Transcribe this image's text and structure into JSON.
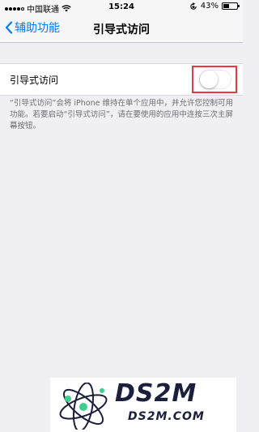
{
  "status_bar": {
    "carrier": "中国联通",
    "time": "15:24",
    "battery_percent": "43%",
    "battery_level": 0.43
  },
  "nav": {
    "back_label": "辅助功能",
    "title": "引导式访问"
  },
  "setting": {
    "label": "引导式访问",
    "toggle_on": false
  },
  "footnote": "“引导式访问”会将 iPhone 维持在单个应用中，并允许您控制可用功能。若要启动“引导式访问”，请在要使用的应用中连按三次主屏幕按钮。",
  "watermark": {
    "title": "DS2M",
    "subtitle": "DS2M.COM"
  },
  "colors": {
    "accent": "#007aff",
    "highlight": "#e53b3b",
    "background": "#efeff4"
  }
}
